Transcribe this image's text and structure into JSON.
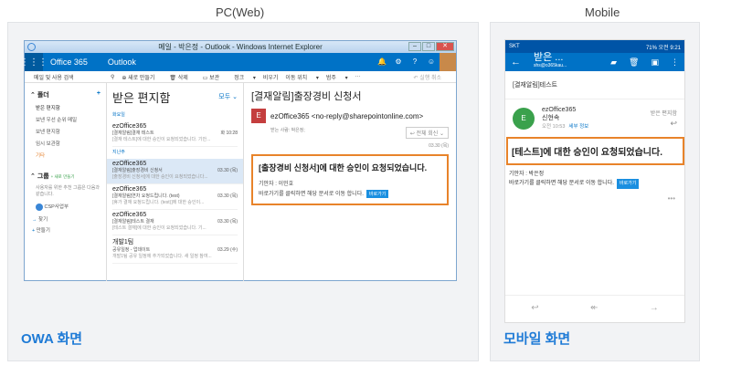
{
  "headings": {
    "pc": "PC(Web)",
    "mobile": "Mobile"
  },
  "captions": {
    "owa": "OWA 화면",
    "mobile": "모바일 화면"
  },
  "owa": {
    "window_title": "메일 - 박은정 - Outlook - Windows Internet Explorer",
    "suite_name": "Office 365",
    "module": "Outlook",
    "commands": {
      "search": "메일 및 사용 검색",
      "new": "새로 만들기",
      "delete": "삭제",
      "archive": "보관",
      "junk": "정크",
      "sweep": "비우기",
      "move": "이동 위치",
      "categories": "범주",
      "undo": "실행 취소"
    },
    "folders": {
      "header": "폴더",
      "items": [
        "받은 편지함",
        "보낸 우선 순위 메일",
        "보낸 편지함",
        "임시 보관함",
        "기타"
      ],
      "groups_header": "그룹",
      "groups_new": "+ 새로 만들기",
      "groups_hint": "사용자를 위한 추천 그룹은 다음과 같습니다.",
      "group_name": "CSP사업부",
      "find": "찾기",
      "create": "만들기"
    },
    "list": {
      "title": "받은 편지함",
      "filter": "모두",
      "day1": "화요일",
      "day2": "지난주",
      "messages": [
        {
          "sender": "ezOffice365",
          "subject": "[결재알림]결재 테스트",
          "date": "화 10:28",
          "preview": "[결재 테스트]에 대한 승인이 요청되었습니다. 기안..."
        },
        {
          "sender": "ezOffice365",
          "subject": "[결재알림]출장경비 신청서",
          "date": "03.30 (목)",
          "preview": "[출장경비 신청서]에 대한 승인이 요청되었습니다..."
        },
        {
          "sender": "ezOffice365",
          "subject": "[결재알림]연차 요청드립니다. (test)",
          "date": "03.30 (목)",
          "preview": "[휴가 결재 요청드립니다. (test)]에 대한 승인이..."
        },
        {
          "sender": "ezOffice365",
          "subject": "[결재알림]테스트 결재",
          "date": "03.30 (목)",
          "preview": "[테스트 결재]에 대한 승인이 요청되었습니다. 기..."
        },
        {
          "sender": "개발1팀",
          "subject": "공유일정 - 업데이트",
          "date": "03.29 (수)",
          "preview": "개발1팀 공유 일정에 추가되었습니다. 새 일정 참여..."
        }
      ]
    },
    "reading": {
      "subject": "[결재알림]출장경비 신청서",
      "from": "ezOffice365 <no-reply@sharepointonline.com>",
      "avatar_letter": "E",
      "to": "받는 사람: 박은정;",
      "reply_all": "전체 회신",
      "date": "03.30 (목)",
      "highlight": "[출장경비 신청서]에 대한 승인이 요청되었습니다.",
      "drafter": "기안자 : 이민호",
      "instruction": "바로가기를 클릭하면 해당 문서로 이동 합니다.",
      "button": "바로가기"
    }
  },
  "mobile": {
    "status_left": "SKT",
    "status_right": "71% 오전 9:21",
    "title": "받은 ...",
    "account": "shs@o365kau...",
    "subject": "[결재알림]테스트",
    "sender": "ezOffice365",
    "recipient": "신현속",
    "time": "오전 10:53",
    "details": "세부 정보",
    "folder": "받은 편지함",
    "avatar_letter": "E",
    "highlight": "[테스트]에 대한 승인이 요청되었습니다.",
    "drafter": "기안자 : 박은정",
    "instruction": "바로가기를 클릭하면 해당 문서로 이동 합니다.",
    "button": "바로가기"
  }
}
